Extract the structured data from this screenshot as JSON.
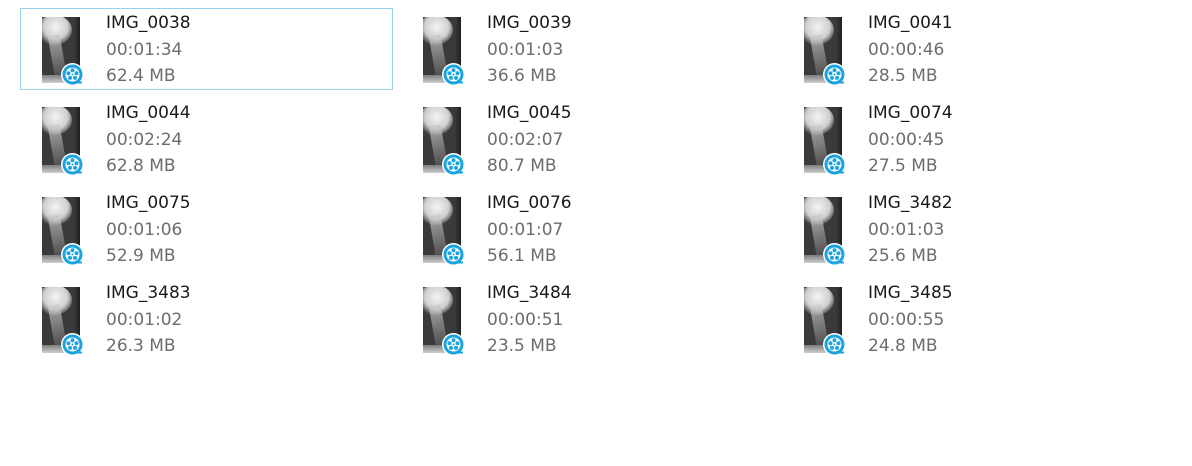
{
  "files": [
    {
      "name": "IMG_0038",
      "duration": "00:01:34",
      "size": "62.4 MB",
      "selected": true,
      "icon": "video-file-icon"
    },
    {
      "name": "IMG_0039",
      "duration": "00:01:03",
      "size": "36.6 MB",
      "selected": false,
      "icon": "video-file-icon"
    },
    {
      "name": "IMG_0041",
      "duration": "00:00:46",
      "size": "28.5 MB",
      "selected": false,
      "icon": "video-file-icon"
    },
    {
      "name": "IMG_0044",
      "duration": "00:02:24",
      "size": "62.8 MB",
      "selected": false,
      "icon": "video-file-icon"
    },
    {
      "name": "IMG_0045",
      "duration": "00:02:07",
      "size": "80.7 MB",
      "selected": false,
      "icon": "video-file-icon"
    },
    {
      "name": "IMG_0074",
      "duration": "00:00:45",
      "size": "27.5 MB",
      "selected": false,
      "icon": "video-file-icon"
    },
    {
      "name": "IMG_0075",
      "duration": "00:01:06",
      "size": "52.9 MB",
      "selected": false,
      "icon": "video-file-icon"
    },
    {
      "name": "IMG_0076",
      "duration": "00:01:07",
      "size": "56.1 MB",
      "selected": false,
      "icon": "video-file-icon"
    },
    {
      "name": "IMG_3482",
      "duration": "00:01:03",
      "size": "25.6 MB",
      "selected": false,
      "icon": "video-file-icon"
    },
    {
      "name": "IMG_3483",
      "duration": "00:01:02",
      "size": "26.3 MB",
      "selected": false,
      "icon": "video-file-icon"
    },
    {
      "name": "IMG_3484",
      "duration": "00:00:51",
      "size": "23.5 MB",
      "selected": false,
      "icon": "video-file-icon"
    },
    {
      "name": "IMG_3485",
      "duration": "00:00:55",
      "size": "24.8 MB",
      "selected": false,
      "icon": "video-file-icon"
    }
  ],
  "colors": {
    "selection_border": "#99d1ec",
    "name_text": "#1a1a1a",
    "meta_text": "#6d6d6d",
    "badge_blue": "#1aa3df"
  }
}
